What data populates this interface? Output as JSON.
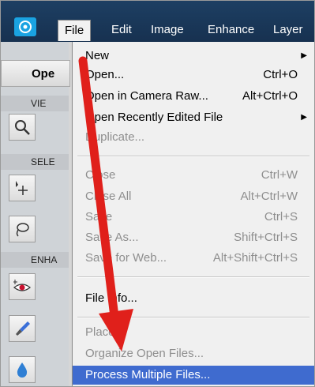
{
  "menubar": {
    "items": [
      "File",
      "Edit",
      "Image",
      "Enhance",
      "Layer"
    ]
  },
  "left_panel": {
    "open_label": "Ope",
    "sections": [
      "VIE",
      "SELE",
      "ENHA"
    ]
  },
  "file_menu": {
    "items": [
      {
        "label": "New",
        "shortcut": "",
        "submenu": true,
        "disabled": false
      },
      {
        "label": "Open...",
        "shortcut": "Ctrl+O",
        "submenu": false,
        "disabled": false
      },
      {
        "label": "Open in Camera Raw...",
        "shortcut": "Alt+Ctrl+O",
        "submenu": false,
        "disabled": false
      },
      {
        "label": "Open Recently Edited File",
        "shortcut": "",
        "submenu": true,
        "disabled": false
      },
      {
        "label": "Duplicate...",
        "shortcut": "",
        "submenu": false,
        "disabled": true
      },
      {
        "label": "Close",
        "shortcut": "Ctrl+W",
        "submenu": false,
        "disabled": true
      },
      {
        "label": "Close All",
        "shortcut": "Alt+Ctrl+W",
        "submenu": false,
        "disabled": true
      },
      {
        "label": "Save",
        "shortcut": "Ctrl+S",
        "submenu": false,
        "disabled": true
      },
      {
        "label": "Save As...",
        "shortcut": "Shift+Ctrl+S",
        "submenu": false,
        "disabled": true
      },
      {
        "label": "Save for Web...",
        "shortcut": "Alt+Shift+Ctrl+S",
        "submenu": false,
        "disabled": true
      },
      {
        "label": "File Info...",
        "shortcut": "",
        "submenu": false,
        "disabled": false
      },
      {
        "label": "Place...",
        "shortcut": "",
        "submenu": false,
        "disabled": true
      },
      {
        "label": "Organize Open Files...",
        "shortcut": "",
        "submenu": false,
        "disabled": true
      },
      {
        "label": "Process Multiple Files...",
        "shortcut": "",
        "submenu": false,
        "disabled": false,
        "highlighted": true
      }
    ]
  },
  "colors": {
    "menubar_bg": "#1d3f63",
    "highlight_bg": "#3f6bcf",
    "annotation_arrow": "#e0201b"
  }
}
